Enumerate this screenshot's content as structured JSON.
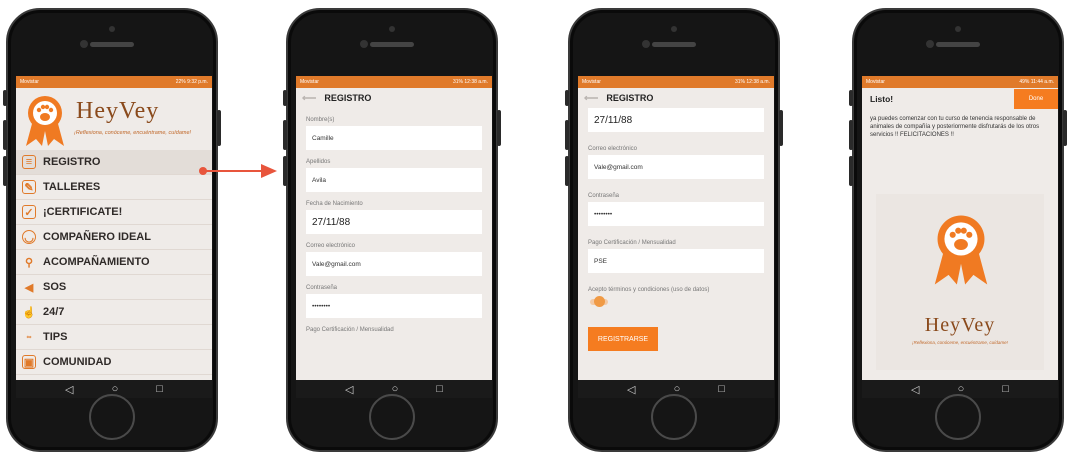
{
  "phone1": {
    "status_left": "Movistar",
    "status_right": "22% 9:32 p.m.",
    "brand": "HeyVey",
    "tagline": "¡Reflexiona, conóceme, encuéntrame, cuídame!",
    "menu": [
      {
        "label": "REGISTRO",
        "icon": "id-card-icon"
      },
      {
        "label": "TALLERES",
        "icon": "edit-icon"
      },
      {
        "label": "¡CERTIFICATE!",
        "icon": "certificate-icon"
      },
      {
        "label": "COMPAÑERO IDEAL",
        "icon": "pet-face-icon"
      },
      {
        "label": "ACOMPAÑAMIENTO",
        "icon": "search-icon"
      },
      {
        "label": "SOS",
        "icon": "megaphone-icon"
      },
      {
        "label": "24/7",
        "icon": "hand-icon"
      },
      {
        "label": "TIPS",
        "icon": "tips-icon"
      },
      {
        "label": "COMUNIDAD",
        "icon": "community-icon"
      }
    ]
  },
  "phone2": {
    "status_left": "Movistar",
    "status_right": "31% 12:38 a.m.",
    "title": "REGISTRO",
    "fields": [
      {
        "label": "Nombre(s)",
        "value": "Camille"
      },
      {
        "label": "Apellidos",
        "value": "Avila"
      },
      {
        "label": "Fecha de Nacimiento",
        "value": "27/11/88"
      },
      {
        "label": "Correo electrónico",
        "value": "Vale@gmail.com"
      },
      {
        "label": "Contraseña",
        "value": "••••••••"
      },
      {
        "label": "Pago Certificación / Mensualidad",
        "value": ""
      }
    ]
  },
  "phone3": {
    "status_left": "Movistar",
    "status_right": "31% 12:38 a.m.",
    "title": "REGISTRO",
    "date_value": "27/11/88",
    "fields": [
      {
        "label": "Correo electrónico",
        "value": "Vale@gmail.com"
      },
      {
        "label": "Contraseña",
        "value": "••••••••"
      },
      {
        "label": "Pago Certificación / Mensualidad",
        "value": "PSE"
      }
    ],
    "terms_label": "Acepto términos y condiciones (uso de datos)",
    "register_button": "REGISTRARSE"
  },
  "phone4": {
    "status_left": "Movistar",
    "status_right": "49% 11:44 a.m.",
    "title": "Listo!",
    "done_button": "Done",
    "message": "ya puedes comenzar con tu curso de tenencia responsable de animales de compañía y posteriormente disfrutarás de los otros servicios !! FELICITACIONES !!",
    "brand": "HeyVey",
    "tagline": "¡Reflexiona, conóceme, encuéntrame, cuídame!"
  },
  "nav": {
    "back": "◁",
    "home": "○",
    "recent": "□"
  },
  "colors": {
    "accent": "#f57c20",
    "brand": "#8a4a1c"
  }
}
